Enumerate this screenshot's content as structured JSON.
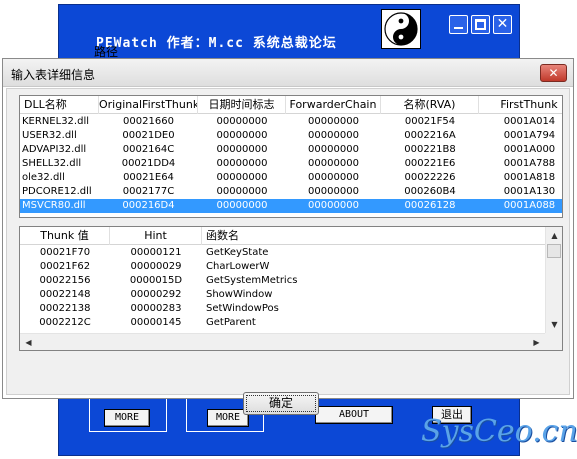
{
  "background_window": {
    "title": "PEWatch  作者：M.cc 系统总裁论坛",
    "path_label": "路径",
    "buttons": {
      "more1": "MORE",
      "more2": "MORE",
      "about": "ABOUT",
      "exit": "退出"
    }
  },
  "watermark": "SysCeo.cn",
  "dialog": {
    "title": "输入表详细信息",
    "close_glyph": "✕",
    "ok_label": "确定",
    "dll_table": {
      "headers": [
        "DLL名称",
        "OriginalFirstThunk",
        "日期时间标志",
        "ForwarderChain",
        "名称(RVA)",
        "FirstThunk"
      ],
      "rows": [
        [
          "KERNEL32.dll",
          "00021660",
          "00000000",
          "00000000",
          "00021F54",
          "0001A014"
        ],
        [
          "USER32.dll",
          "00021DE0",
          "00000000",
          "00000000",
          "0002216A",
          "0001A794"
        ],
        [
          "ADVAPI32.dll",
          "0002164C",
          "00000000",
          "00000000",
          "000221B8",
          "0001A000"
        ],
        [
          "SHELL32.dll",
          "00021DD4",
          "00000000",
          "00000000",
          "000221E6",
          "0001A788"
        ],
        [
          "ole32.dll",
          "00021E64",
          "00000000",
          "00000000",
          "00022226",
          "0001A818"
        ],
        [
          "PDCORE12.dll",
          "0002177C",
          "00000000",
          "00000000",
          "000260B4",
          "0001A130"
        ],
        [
          "MSVCR80.dll",
          "000216D4",
          "00000000",
          "00000000",
          "00026128",
          "0001A088"
        ]
      ],
      "selected_row": 6
    },
    "func_table": {
      "headers": [
        "Thunk 值",
        "Hint",
        "函数名"
      ],
      "rows": [
        [
          "00021F70",
          "00000121",
          "GetKeyState"
        ],
        [
          "00021F62",
          "00000029",
          "CharLowerW"
        ],
        [
          "00022156",
          "0000015D",
          "GetSystemMetrics"
        ],
        [
          "00022148",
          "00000292",
          "ShowWindow"
        ],
        [
          "00022138",
          "00000283",
          "SetWindowPos"
        ],
        [
          "0002212C",
          "00000145",
          "GetParent"
        ]
      ]
    }
  },
  "colors": {
    "background_window": "#0c48d6",
    "selection": "#3399ff",
    "dialog_face": "#f0f0f0",
    "close_button": "#c0392b"
  },
  "icons": [
    "yin-yang-icon",
    "minimize-icon",
    "maximize-icon",
    "close-icon",
    "scroll-up-icon",
    "scroll-down-icon",
    "scroll-left-icon",
    "scroll-right-icon"
  ]
}
